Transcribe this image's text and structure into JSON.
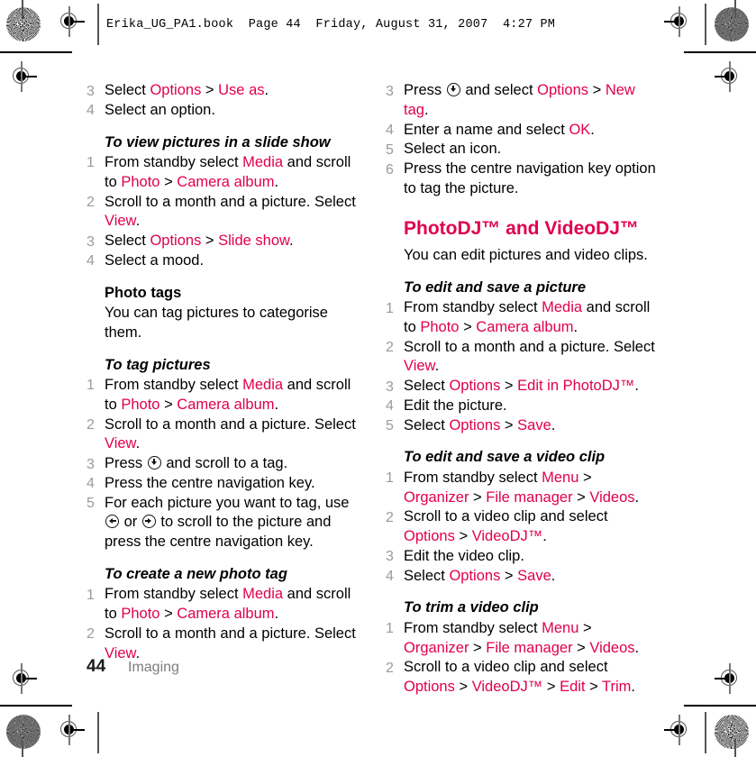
{
  "header": {
    "line": "Erika_UG_PA1.book  Page 44  Friday, August 31, 2007  4:27 PM"
  },
  "colors": {
    "accent_pink": "#E0004D",
    "body_text": "#000000",
    "step_number": "#9A9A9A",
    "footer_chapter": "#7D7D7D"
  },
  "left_column": {
    "step_3_label": "3",
    "step_3_a": "Select ",
    "step_3_options": "Options",
    "step_3_gt": " > ",
    "step_3_useas": "Use as",
    "step_3_end": ".",
    "step_4_label": "4",
    "step_4_text": "Select an option.",
    "h_slideshow": "To view pictures in a slide show",
    "ss_1_label": "1",
    "ss_1_a": "From standby select ",
    "ss_1_media": "Media",
    "ss_1_b": " and scroll to ",
    "ss_1_photo": "Photo",
    "ss_1_gt": " > ",
    "ss_1_album": "Camera album",
    "ss_1_end": ".",
    "ss_2_label": "2",
    "ss_2_a": "Scroll to a month and a picture. Select ",
    "ss_2_view": "View",
    "ss_2_end": ".",
    "ss_3_label": "3",
    "ss_3_a": "Select ",
    "ss_3_options": "Options",
    "ss_3_gt": " > ",
    "ss_3_slideshow": "Slide show",
    "ss_3_end": ".",
    "ss_4_label": "4",
    "ss_4_text": "Select a mood.",
    "h_phototags": "Photo tags",
    "phototags_body": "You can tag pictures to categorise them.",
    "h_tagpictures": "To tag pictures",
    "tp_1_label": "1",
    "tp_1_a": "From standby select ",
    "tp_1_media": "Media",
    "tp_1_b": " and scroll to ",
    "tp_1_photo": "Photo",
    "tp_1_gt": " > ",
    "tp_1_album": "Camera album",
    "tp_1_end": ".",
    "tp_2_label": "2",
    "tp_2_a": "Scroll to a month and a picture. Select ",
    "tp_2_view": "View",
    "tp_2_end": ".",
    "tp_3_label": "3",
    "tp_3_a": "Press ",
    "tp_3_b": " and scroll to a tag.",
    "tp_4_label": "4",
    "tp_4_text": "Press the centre navigation key.",
    "tp_5_label": "5",
    "tp_5_a": "For each picture you want to tag, use ",
    "tp_5_or": " or ",
    "tp_5_b": " to scroll to the picture and press the centre navigation key.",
    "h_newphototag": "To create a new photo tag",
    "nt_1_label": "1",
    "nt_1_a": "From standby select ",
    "nt_1_media": "Media",
    "nt_1_b": " and scroll to ",
    "nt_1_photo": "Photo",
    "nt_1_gt": " > ",
    "nt_1_album": "Camera album",
    "nt_1_end": ".",
    "nt_2_label": "2",
    "nt_2_a": "Scroll to a month and a picture. Select ",
    "nt_2_view": "View",
    "nt_2_end": "."
  },
  "right_column": {
    "nt_3_label": "3",
    "nt_3_a": "Press ",
    "nt_3_b": " and select ",
    "nt_3_options": "Options",
    "nt_3_gt": " > ",
    "nt_3_newtag": "New tag",
    "nt_3_end": ".",
    "nt_4_label": "4",
    "nt_4_a": "Enter a name and select ",
    "nt_4_ok": "OK",
    "nt_4_end": ".",
    "nt_5_label": "5",
    "nt_5_text": "Select an icon.",
    "nt_6_label": "6",
    "nt_6_text": "Press the centre navigation key option to tag the picture.",
    "h_photodj": "PhotoDJ™ and VideoDJ™",
    "photodj_body": "You can edit pictures and video clips.",
    "h_editpicture": "To edit and save a picture",
    "ep_1_label": "1",
    "ep_1_a": "From standby select ",
    "ep_1_media": "Media",
    "ep_1_b": " and scroll to ",
    "ep_1_photo": "Photo",
    "ep_1_gt": " > ",
    "ep_1_album": "Camera album",
    "ep_1_end": ".",
    "ep_2_label": "2",
    "ep_2_a": "Scroll to a month and a picture. Select ",
    "ep_2_view": "View",
    "ep_2_end": ".",
    "ep_3_label": "3",
    "ep_3_a": "Select ",
    "ep_3_options": "Options",
    "ep_3_gt": " > ",
    "ep_3_edit": "Edit in PhotoDJ™",
    "ep_3_end": ".",
    "ep_4_label": "4",
    "ep_4_text": "Edit the picture.",
    "ep_5_label": "5",
    "ep_5_a": "Select ",
    "ep_5_options": "Options",
    "ep_5_gt": " > ",
    "ep_5_save": "Save",
    "ep_5_end": ".",
    "h_editvideo": "To edit and save a video clip",
    "ev_1_label": "1",
    "ev_1_a": "From standby select ",
    "ev_1_menu": "Menu",
    "ev_1_gt1": " > ",
    "ev_1_organizer": "Organizer",
    "ev_1_gt2": " > ",
    "ev_1_filemanager": "File manager",
    "ev_1_gt3": " > ",
    "ev_1_videos": "Videos",
    "ev_1_end": ".",
    "ev_2_label": "2",
    "ev_2_a": "Scroll to a video clip and select ",
    "ev_2_options": "Options",
    "ev_2_gt": " > ",
    "ev_2_videodj": "VideoDJ™",
    "ev_2_end": ".",
    "ev_3_label": "3",
    "ev_3_text": "Edit the video clip.",
    "ev_4_label": "4",
    "ev_4_a": "Select ",
    "ev_4_options": "Options",
    "ev_4_gt": " > ",
    "ev_4_save": "Save",
    "ev_4_end": ".",
    "h_trimvideo": "To trim a video clip",
    "tv_1_label": "1",
    "tv_1_a": "From standby select ",
    "tv_1_menu": "Menu",
    "tv_1_gt1": " > ",
    "tv_1_organizer": "Organizer",
    "tv_1_gt2": " > ",
    "tv_1_filemanager": "File manager",
    "tv_1_gt3": " > ",
    "tv_1_videos": "Videos",
    "tv_1_end": ".",
    "tv_2_label": "2",
    "tv_2_a": "Scroll to a video clip and select ",
    "tv_2_options": "Options",
    "tv_2_gt1": " > ",
    "tv_2_videodj": "VideoDJ™",
    "tv_2_gt2": " > ",
    "tv_2_edit": "Edit",
    "tv_2_gt3": " > ",
    "tv_2_trim": "Trim",
    "tv_2_end": "."
  },
  "footer": {
    "page_number": "44",
    "chapter": "Imaging"
  },
  "icons": {
    "nav_down": "navigation-key-down-icon",
    "nav_left": "navigation-key-left-icon",
    "nav_right": "navigation-key-right-icon",
    "registration": "registration-mark-icon",
    "star_target": "star-target-mark-icon"
  }
}
